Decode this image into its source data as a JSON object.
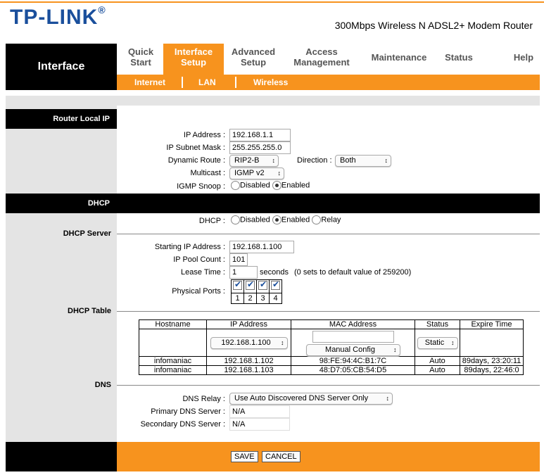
{
  "brand": {
    "logo": "TP-LINK",
    "reg": "®",
    "model": "300Mbps Wireless N ADSL2+ Modem Router"
  },
  "nav": {
    "section_title": "Interface",
    "items": [
      {
        "line1": "Quick",
        "line2": "Start"
      },
      {
        "line1": "Interface",
        "line2": "Setup"
      },
      {
        "line1": "Advanced",
        "line2": "Setup"
      },
      {
        "line1": "Access",
        "line2": "Management"
      },
      {
        "line1": "Maintenance",
        "line2": ""
      },
      {
        "line1": "Status",
        "line2": ""
      },
      {
        "line1": "Help",
        "line2": ""
      }
    ],
    "sub_items": [
      "Internet",
      "LAN",
      "Wireless"
    ]
  },
  "router_local_ip": {
    "title": "Router Local IP",
    "ip_label": "IP Address :",
    "ip_value": "192.168.1.1",
    "mask_label": "IP Subnet Mask :",
    "mask_value": "255.255.255.0",
    "dyn_label": "Dynamic Route :",
    "dyn_value": "RIP2-B",
    "dir_label": "Direction :",
    "dir_value": "Both",
    "mc_label": "Multicast :",
    "mc_value": "IGMP v2",
    "igmp_label": "IGMP Snoop :",
    "igmp_opt1": "Disabled",
    "igmp_opt2": "Enabled"
  },
  "dhcp": {
    "title": "DHCP",
    "label": "DHCP :",
    "opt1": "Disabled",
    "opt2": "Enabled",
    "opt3": "Relay",
    "server_title": "DHCP Server",
    "start_label": "Starting IP Address :",
    "start_value": "192.168.1.100",
    "pool_label": "IP Pool Count :",
    "pool_value": "101",
    "lease_label": "Lease Time :",
    "lease_value": "1",
    "lease_unit": "seconds",
    "lease_note": "(0 sets to default value of 259200)",
    "ports_label": "Physical Ports :",
    "ports": [
      "1",
      "2",
      "3",
      "4"
    ],
    "table_title": "DHCP Table",
    "table_headers": [
      "Hostname",
      "IP Address",
      "MAC Address",
      "Status",
      "Expire Time"
    ],
    "table_ip_select": "192.168.1.100",
    "table_mac_select": "Manual Config",
    "table_status_select": "Static",
    "rows": [
      {
        "host": "infomaniac",
        "ip": "192.168.1.102",
        "mac": "98:FE:94:4C:B1:7C",
        "status": "Auto",
        "expire": "89days, 23:20:11"
      },
      {
        "host": "infomaniac",
        "ip": "192.168.1.103",
        "mac": "48:D7:05:CB:54:D5",
        "status": "Auto",
        "expire": "89days, 22:46:0"
      }
    ]
  },
  "dns": {
    "title": "DNS",
    "relay_label": "DNS Relay :",
    "relay_value": "Use Auto Discovered DNS Server Only",
    "primary_label": "Primary DNS Server :",
    "primary_value": "N/A",
    "secondary_label": "Secondary DNS Server :",
    "secondary_value": "N/A"
  },
  "buttons": {
    "save": "SAVE",
    "cancel": "CANCEL"
  },
  "colors": {
    "accent": "#f7931e",
    "brand_blue": "#1a4f9c"
  }
}
